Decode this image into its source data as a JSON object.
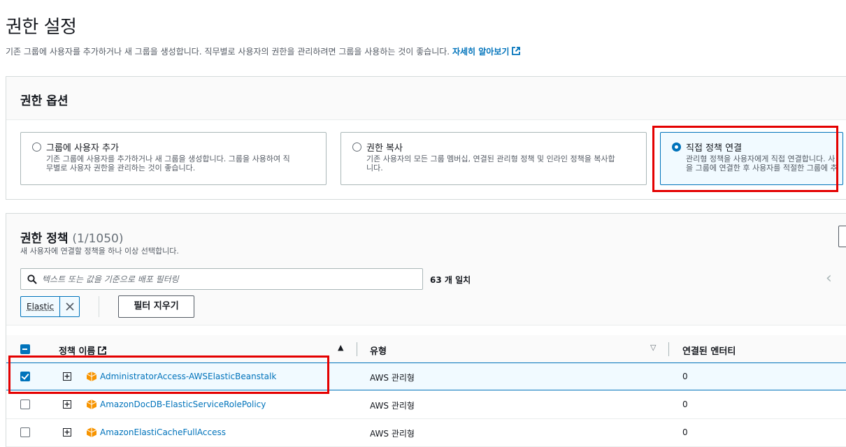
{
  "page": {
    "title": "권한 설정",
    "description": "기존 그룹에 사용자를 추가하거나 새 그룹을 생성합니다. 직무별로 사용자의 권한을 관리하려면 그룹을 사용하는 것이 좋습니다.",
    "learn_more": "자세히 알아보기"
  },
  "options_panel": {
    "title": "권한 옵션",
    "options": [
      {
        "label": "그룹에 사용자 추가",
        "description": "기존 그룹에 사용자를 추가하거나 새 그룹을 생성합니다. 그룹을 사용하여 직\n무별로 사용자 권한을 관리하는 것이 좋습니다.",
        "selected": false
      },
      {
        "label": "권한 복사",
        "description": "기존 사용자의 모든 그룹 멤버십, 연결된 관리형 정책 및 인라인 정책을 복사합\n니다.",
        "selected": false
      },
      {
        "label": "직접 정책 연결",
        "description": "관리형 정책을 사용자에게 직접 연결합니다. 사\n을 그룹에 연결한 후 사용자를 적절한 그룹에 추",
        "selected": true
      }
    ]
  },
  "policies_panel": {
    "title": "권한 정책",
    "count": "(1/1050)",
    "subtitle": "새 사용자에 연결할 정책을 하나 이상 선택합니다.",
    "search_placeholder": "텍스트 또는 값을 기준으로 배포 필터링",
    "match_text": "63 개 일치",
    "filter_token": "Elastic",
    "clear_filters": "필터 지우기",
    "pager_prev": "‹",
    "columns": {
      "name": "정책 이름",
      "type": "유형",
      "entities": "연결된 엔터티"
    },
    "rows": [
      {
        "name": "AdministratorAccess-AWSElasticBeanstalk",
        "type": "AWS 관리형",
        "entities": "0",
        "checked": true
      },
      {
        "name": "AmazonDocDB-ElasticServiceRolePolicy",
        "type": "AWS 관리형",
        "entities": "0",
        "checked": false
      },
      {
        "name": "AmazonElastiCacheFullAccess",
        "type": "AWS 관리형",
        "entities": "0",
        "checked": false
      }
    ]
  },
  "colors": {
    "link": "#0073bb",
    "highlight": "#e40000",
    "selected_bg": "#f1faff",
    "aws_orange": "#f79400"
  }
}
